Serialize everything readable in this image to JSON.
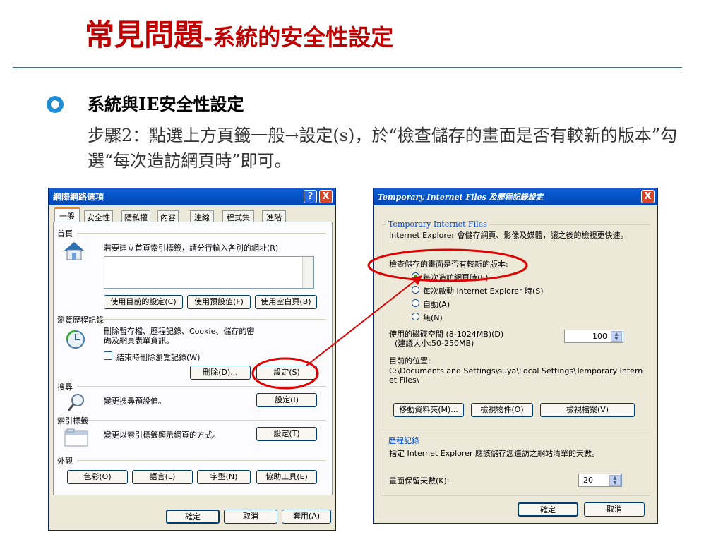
{
  "slide": {
    "title_main": "常見問題",
    "title_sub": "-系統的安全性設定",
    "subheading": "系統與IE安全性設定",
    "paragraph": "步驟2：點選上方頁籤一般→設定(s)，於“檢查儲存的畫面是否有較新的版本”勾選“每次造訪網頁時”即可。"
  },
  "internet_options": {
    "title": "網際網路選項",
    "help_btn": "?",
    "close_btn": "X",
    "tabs": [
      "一般",
      "安全性",
      "隱私權",
      "內容",
      "連線",
      "程式集",
      "進階"
    ],
    "home": {
      "heading": "首頁",
      "text": "若要建立首頁索引標籤，請分行輸入各別的網址(R)",
      "btn_current": "使用目前的設定(C)",
      "btn_default": "使用預設值(F)",
      "btn_blank": "使用空白頁(B)"
    },
    "history": {
      "heading": "瀏覽歷程記錄",
      "text": "刪除暫存檔、歷程記錄、Cookie、儲存的密碼及網頁表單資訊。",
      "checkbox": "結束時刪除瀏覽記錄(W)",
      "btn_delete": "刪除(D)...",
      "btn_settings": "設定(S)"
    },
    "search": {
      "heading": "搜尋",
      "text": "變更搜尋預設值。",
      "btn": "設定(I)"
    },
    "tabs_group": {
      "heading": "索引標籤",
      "text": "變更以索引標籤顯示網頁的方式。",
      "btn": "設定(T)"
    },
    "appearance": {
      "heading": "外觀",
      "btn_colors": "色彩(O)",
      "btn_lang": "語言(L)",
      "btn_fonts": "字型(N)",
      "btn_access": "協助工具(E)"
    },
    "footer": {
      "ok": "確定",
      "cancel": "取消",
      "apply": "套用(A)"
    }
  },
  "tif_dialog": {
    "title": "Temporary Internet Files 及歷程記錄設定",
    "close_btn": "X",
    "tif": {
      "heading": "Temporary Internet Files",
      "text": "Internet Explorer 會儲存網頁、影像及媒體，讓之後的檢視更快速。",
      "check_label": "檢查儲存的畫面是否有較新的版本:",
      "options": [
        "每次造訪網頁時(E)",
        "每次啟動 Internet Explorer 時(S)",
        "自動(A)",
        "無(N)"
      ],
      "selected": 0,
      "disk_label_1": "使用的磁碟空間 (8-1024MB)(D)",
      "disk_label_2": "(建議大小:50-250MB)",
      "disk_value": "100",
      "location_label": "目前的位置:",
      "location_path": "C:\\Documents and Settings\\suya\\Local Settings\\Temporary Internet Files\\",
      "btn_move": "移動資料夾(M)...",
      "btn_objects": "檢視物件(O)",
      "btn_files": "檢視檔案(V)"
    },
    "history": {
      "heading": "歷程記錄",
      "text": "指定 Internet Explorer 應該儲存您造訪之網站清單的天數。",
      "days_label": "畫面保留天數(K):",
      "days_value": "20"
    },
    "footer": {
      "ok": "確定",
      "cancel": "取消"
    }
  },
  "colors": {
    "title_red": "#c00000",
    "xp_blue": "#0550c2",
    "annotation_red": "#e00000"
  }
}
